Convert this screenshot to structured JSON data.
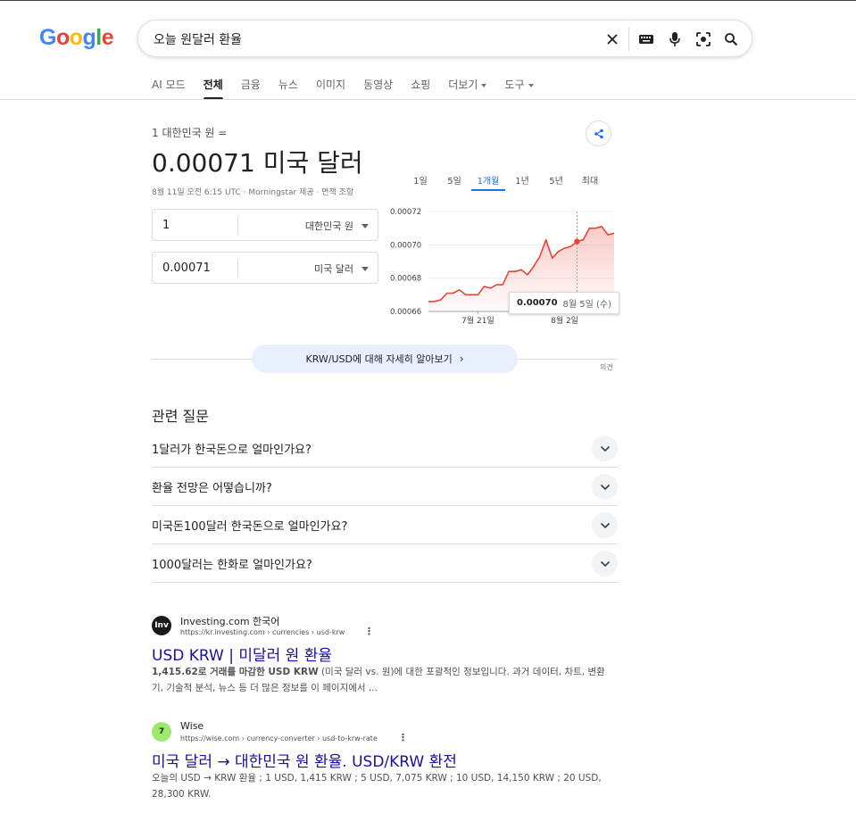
{
  "search": {
    "query": "오늘 원달러 환율"
  },
  "logo_letters": [
    {
      "ch": "G",
      "color": "#4285F4"
    },
    {
      "ch": "o",
      "color": "#EA4335"
    },
    {
      "ch": "o",
      "color": "#FBBC05"
    },
    {
      "ch": "g",
      "color": "#4285F4"
    },
    {
      "ch": "l",
      "color": "#34A853"
    },
    {
      "ch": "e",
      "color": "#EA4335"
    }
  ],
  "tabs": [
    {
      "label": "AI 모드",
      "active": false,
      "dropdown": false
    },
    {
      "label": "전체",
      "active": true,
      "dropdown": false
    },
    {
      "label": "금융",
      "active": false,
      "dropdown": false
    },
    {
      "label": "뉴스",
      "active": false,
      "dropdown": false
    },
    {
      "label": "이미지",
      "active": false,
      "dropdown": false
    },
    {
      "label": "동영상",
      "active": false,
      "dropdown": false
    },
    {
      "label": "쇼핑",
      "active": false,
      "dropdown": false
    },
    {
      "label": "더보기",
      "active": false,
      "dropdown": true
    },
    {
      "label": "도구",
      "active": false,
      "dropdown": true
    }
  ],
  "converter": {
    "from_line": "1 대한민국 원 =",
    "result": "0.00071 미국 달러",
    "meta": "8월 11일 오전 6:15 UTC · Morningstar 제공 · 면책 조항",
    "from_value": "1",
    "from_currency": "대한민국 원",
    "to_value": "0.00071",
    "to_currency": "미국 달러"
  },
  "ranges": [
    {
      "label": "1일",
      "active": false
    },
    {
      "label": "5일",
      "active": false
    },
    {
      "label": "1개월",
      "active": true
    },
    {
      "label": "1년",
      "active": false
    },
    {
      "label": "5년",
      "active": false
    },
    {
      "label": "최대",
      "active": false
    }
  ],
  "chart_data": {
    "type": "area",
    "ylim": [
      0.00066,
      0.00072
    ],
    "y_ticks": [
      "0.00072",
      "0.00070",
      "0.00068",
      "0.00066"
    ],
    "y_tick_values": [
      0.00072,
      0.0007,
      0.00068,
      0.00066
    ],
    "x_tick_labels": [
      "7월 21일",
      "8월 2일"
    ],
    "x_tick_index": [
      8,
      22
    ],
    "values": [
      0.000666,
      0.000666,
      0.000667,
      0.000671,
      0.000671,
      0.000673,
      0.00067,
      0.00067,
      0.00067,
      0.000675,
      0.000674,
      0.000676,
      0.000676,
      0.000684,
      0.000684,
      0.000685,
      0.000682,
      0.000687,
      0.000693,
      0.000703,
      0.000692,
      0.000696,
      0.000698,
      0.000699,
      0.000702,
      0.000703,
      0.00071,
      0.00071,
      0.000711,
      0.000706,
      0.000707
    ],
    "highlight_index": 24,
    "line_color": "#EA4335",
    "grid": true
  },
  "tooltip": {
    "value": "0.00070",
    "date": "8월 5일 (수)"
  },
  "learn_more": {
    "label": "KRW/USD에 대해 자세히 알아보기"
  },
  "feedback": "의견",
  "related": {
    "title": "관련 질문",
    "questions": [
      "1달러가 한국돈으로 얼마인가요?",
      "환율 전망은 어떻습니까?",
      "미국돈100달러 한국돈으로 얼마인가요?",
      "1000달러는 한화로 얼마인가요?"
    ]
  },
  "results": [
    {
      "site": "Investing.com 한국어",
      "url": "https://kr.investing.com › currencies › usd-krw",
      "title": "USD KRW | 미달러 원 환율",
      "snippet_bold": "1,415.62로 거래를 마감한 USD KRW",
      "snippet_rest": " (미국 달러 vs. 원)에 대한 포괄적인 정보입니다. 과거 데이터, 차트, 변환기, 기술적 분석, 뉴스 등 더 많은 정보를 이 페이지에서 ...",
      "favicon_text": "Inv",
      "favicon_bg": "#1a1a1a",
      "favicon_fg": "#ffffff"
    },
    {
      "site": "Wise",
      "url": "https://wise.com › currency-converter › usd-to-krw-rate",
      "title": "미국 달러 → 대한민국 원 환율. USD/KRW 환전",
      "snippet_bold": "",
      "snippet_rest": "오늘의 USD → KRW 환율 ; 1 USD, 1,415 KRW ; 5 USD, 7,075 KRW ; 10 USD, 14,150 KRW ; 20 USD, 28,300 KRW.",
      "favicon_text": "7",
      "favicon_bg": "#9fe870",
      "favicon_fg": "#163300"
    }
  ]
}
